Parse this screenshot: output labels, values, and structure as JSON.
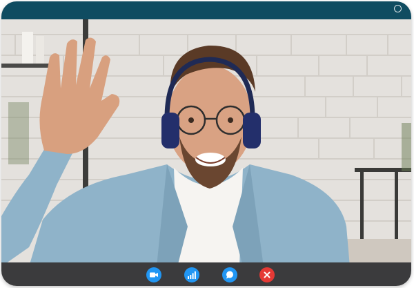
{
  "window": {
    "title_bar_color": "#0f4c61",
    "controls_bar_color": "#3b3b3d"
  },
  "video_feed": {
    "description_icon": "person-waving-video-feed"
  },
  "controls": [
    {
      "name": "camera-button",
      "icon": "video-camera-icon",
      "color": "#2196f3"
    },
    {
      "name": "signal-button",
      "icon": "signal-bars-icon",
      "color": "#2196f3"
    },
    {
      "name": "chat-button",
      "icon": "chat-bubble-icon",
      "color": "#2196f3"
    },
    {
      "name": "end-call-button",
      "icon": "close-icon",
      "color": "#e53935"
    }
  ]
}
